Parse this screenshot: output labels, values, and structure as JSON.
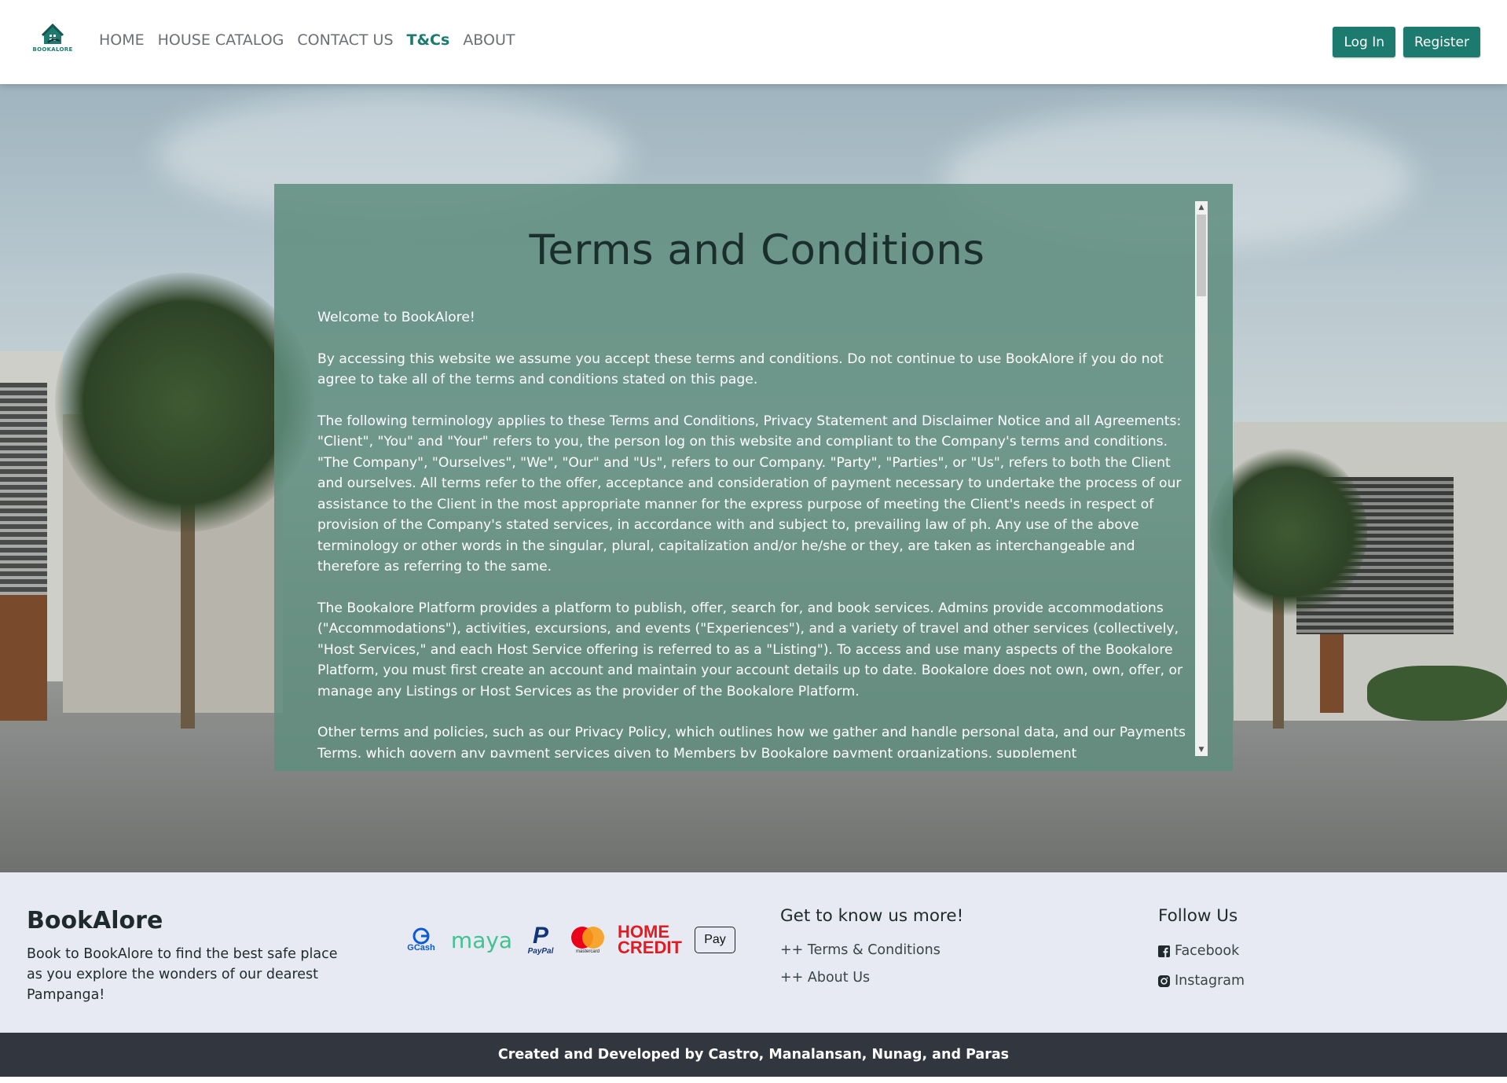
{
  "nav": {
    "logo_text": "BOOKALORE",
    "links": [
      {
        "label": "HOME"
      },
      {
        "label": "HOUSE CATALOG"
      },
      {
        "label": "CONTACT US"
      },
      {
        "label": "T&Cs",
        "active": true
      },
      {
        "label": "ABOUT"
      }
    ],
    "login_label": "Log In",
    "register_label": "Register"
  },
  "terms": {
    "title": "Terms and Conditions",
    "paragraphs": [
      "Welcome to BookAlore!",
      "By accessing this website we assume you accept these terms and conditions. Do not continue to use BookAlore if you do not agree to take all of the terms and conditions stated on this page.",
      "The following terminology applies to these Terms and Conditions, Privacy Statement and Disclaimer Notice and all Agreements: \"Client\", \"You\" and \"Your\" refers to you, the person log on this website and compliant to the Company's terms and conditions. \"The Company\", \"Ourselves\", \"We\", \"Our\" and \"Us\", refers to our Company. \"Party\", \"Parties\", or \"Us\", refers to both the Client and ourselves. All terms refer to the offer, acceptance and consideration of payment necessary to undertake the process of our assistance to the Client in the most appropriate manner for the express purpose of meeting the Client's needs in respect of provision of the Company's stated services, in accordance with and subject to, prevailing law of ph. Any use of the above terminology or other words in the singular, plural, capitalization and/or he/she or they, are taken as interchangeable and therefore as referring to the same.",
      "The Bookalore Platform provides a platform to publish, offer, search for, and book services. Admins provide accommodations (\"Accommodations\"), activities, excursions, and events (\"Experiences\"), and a variety of travel and other services (collectively, \"Host Services,\" and each Host Service offering is referred to as a \"Listing\"). To access and use many aspects of the Bookalore Platform, you must first create an account and maintain your account details up to date. Bookalore does not own, own, offer, or manage any Listings or Host Services as the provider of the Bookalore Platform.",
      "Other terms and policies, such as our Privacy Policy, which outlines how we gather and handle personal data, and our Payments Terms, which govern any payment services given to Members by Bookalore payment organizations, supplement"
    ]
  },
  "footer": {
    "brand": "BookAlore",
    "description": "Book to BookAlore to find the best safe place as you explore the wonders of our dearest Pampanga!",
    "payments": [
      {
        "name": "GCash",
        "icon": "gcash-logo"
      },
      {
        "name": "maya",
        "icon": "maya-logo"
      },
      {
        "name": "PayPal",
        "icon": "paypal-logo"
      },
      {
        "name": "mastercard",
        "icon": "mastercard-logo"
      },
      {
        "name": "HOME CREDIT",
        "icon": "home-credit-logo"
      },
      {
        "name": "Pay",
        "icon": "apple-pay-logo"
      }
    ],
    "know_title": "Get to know us more!",
    "know_links": [
      "++ Terms & Conditions",
      "++ About Us"
    ],
    "follow_title": "Follow Us",
    "social": [
      {
        "label": "Facebook",
        "icon": "facebook-icon"
      },
      {
        "label": "Instagram",
        "icon": "instagram-icon"
      }
    ],
    "credits": "Created and Developed by Castro, Manalansan, Nunag, and Paras"
  },
  "colors": {
    "accent": "#1c7a6e",
    "panel": "#5f8d7e",
    "footer_bg": "#e8eaf3",
    "bottom_bar": "#31363f"
  }
}
